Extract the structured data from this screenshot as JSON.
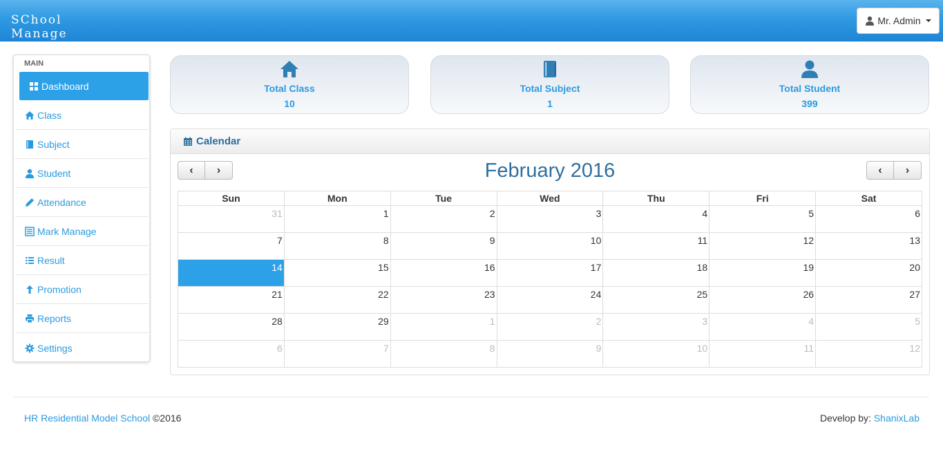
{
  "header": {
    "brand_line1": "SChool",
    "brand_line2": "Manage",
    "user_button": "Mr. Admin"
  },
  "sidebar": {
    "heading": "MAIN",
    "items": [
      {
        "label": "Dashboard",
        "icon": "dashboard-icon",
        "active": true
      },
      {
        "label": "Class",
        "icon": "home-icon"
      },
      {
        "label": "Subject",
        "icon": "book-icon"
      },
      {
        "label": "Student",
        "icon": "user-icon"
      },
      {
        "label": "Attendance",
        "icon": "pencil-icon"
      },
      {
        "label": "Mark Manage",
        "icon": "list-alt-icon"
      },
      {
        "label": "Result",
        "icon": "list-icon"
      },
      {
        "label": "Promotion",
        "icon": "arrow-up-icon"
      },
      {
        "label": "Reports",
        "icon": "print-icon"
      },
      {
        "label": "Settings",
        "icon": "gear-icon"
      }
    ]
  },
  "stats": [
    {
      "label": "Total Class",
      "value": "10",
      "icon": "home-icon"
    },
    {
      "label": "Total Subject",
      "value": "1",
      "icon": "book-icon"
    },
    {
      "label": "Total Student",
      "value": "399",
      "icon": "user-icon"
    }
  ],
  "calendar": {
    "panel_title": "Calendar",
    "month_title": "February 2016",
    "prev": "‹",
    "next": "›",
    "weekdays": [
      "Sun",
      "Mon",
      "Tue",
      "Wed",
      "Thu",
      "Fri",
      "Sat"
    ],
    "weeks": [
      [
        "31",
        "1",
        "2",
        "3",
        "4",
        "5",
        "6"
      ],
      [
        "7",
        "8",
        "9",
        "10",
        "11",
        "12",
        "13"
      ],
      [
        "14",
        "15",
        "16",
        "17",
        "18",
        "19",
        "20"
      ],
      [
        "21",
        "22",
        "23",
        "24",
        "25",
        "26",
        "27"
      ],
      [
        "28",
        "29",
        "1",
        "2",
        "3",
        "4",
        "5"
      ],
      [
        "6",
        "7",
        "8",
        "9",
        "10",
        "11",
        "12"
      ]
    ],
    "today": "14"
  },
  "footer": {
    "school_link": "HR Residential Model School",
    "copyright": "©2016",
    "develop_by": "Develop by: ",
    "developer_link": "ShanixLab"
  },
  "colors": {
    "accent": "#2da1e8",
    "link": "#2a9ae0",
    "title": "#2f6f9f"
  }
}
